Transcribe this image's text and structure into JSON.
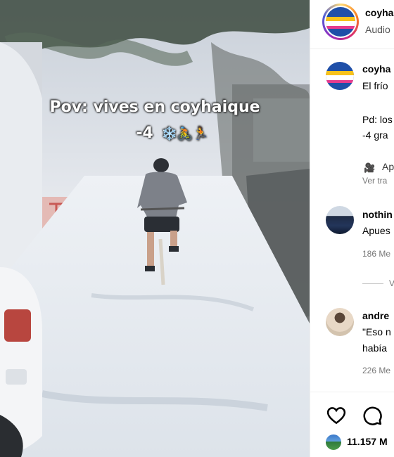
{
  "post": {
    "overlay_line1": "Pov: vives en coyhaique",
    "overlay_line2": "-4",
    "overlay_emojis": "❄️🚴🏃"
  },
  "header": {
    "username": "coyha",
    "subtitle": "Audio"
  },
  "caption": {
    "username": "coyha",
    "line1": "El frío",
    "line2": "Pd: los",
    "line3": "-4 gra",
    "translation_icon": "🎥",
    "translation_label": "Ap",
    "see_translation": "Ver tra"
  },
  "comments": [
    {
      "username": "nothin",
      "text": "Apues",
      "meta": "186 Me"
    },
    {
      "username": "andre",
      "text_line1": "\"Eso n",
      "text_line2": "había",
      "meta": "226 Me"
    }
  ],
  "replies_toggle": "V",
  "actions": {
    "like_icon": "heart-icon",
    "comment_icon": "comment-icon",
    "likes_count": "11.157 M"
  }
}
